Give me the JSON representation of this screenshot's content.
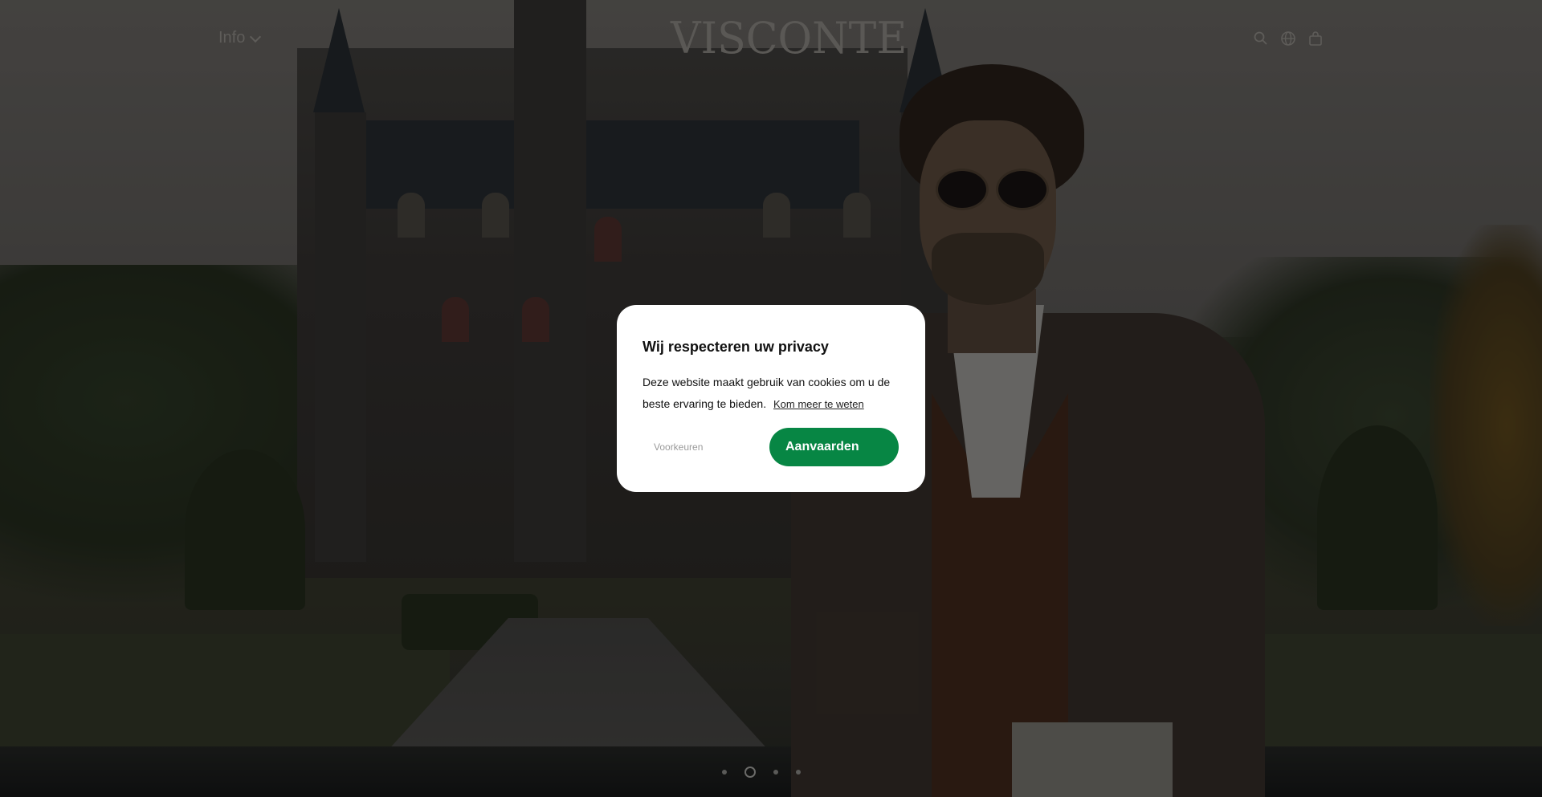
{
  "header": {
    "nav_info_label": "Info",
    "logo_text": "VISCONTE",
    "icons": [
      "search-icon",
      "globe-icon",
      "bag-icon"
    ]
  },
  "cookie_modal": {
    "title": "Wij respecteren uw privacy",
    "body": "Deze website maakt gebruik van cookies om u de beste ervaring te bieden.",
    "learn_more_link": "Kom meer te weten",
    "preferences_label": "Voorkeuren",
    "accept_label": "Aanvaarden"
  },
  "slider": {
    "slide_count": 4,
    "active_index": 1
  },
  "colors": {
    "accent": "#078644",
    "overlay": "rgba(0,0,0,0.45)",
    "modal_bg": "#ffffff"
  }
}
